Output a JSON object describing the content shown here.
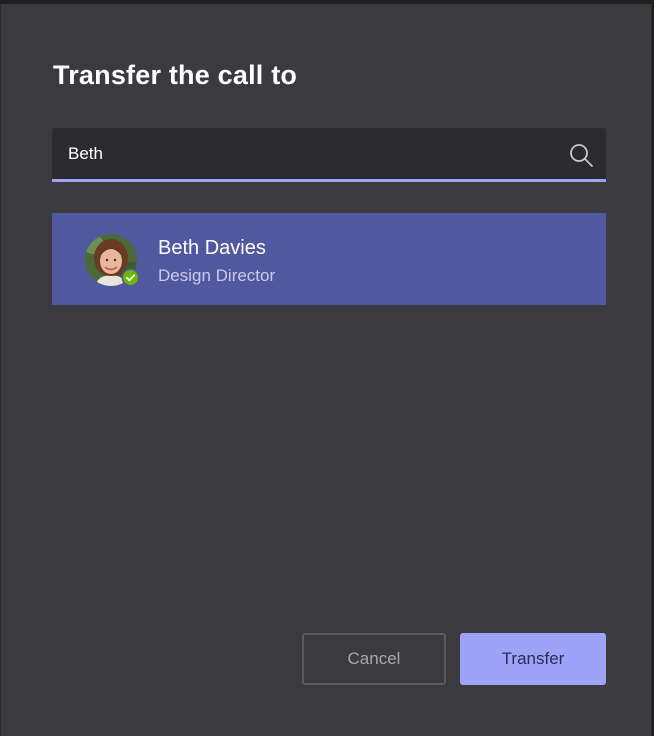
{
  "dialog": {
    "title": "Transfer the call to"
  },
  "search": {
    "value": "Beth",
    "icon": "search-icon"
  },
  "results": [
    {
      "name": "Beth Davies",
      "role": "Design Director",
      "presence": "available",
      "presence_color": "#6bb700"
    }
  ],
  "buttons": {
    "cancel_label": "Cancel",
    "transfer_label": "Transfer"
  },
  "colors": {
    "background": "#3b3a3f",
    "accent": "#9ea2f8",
    "selected_row": "#5059a0"
  }
}
